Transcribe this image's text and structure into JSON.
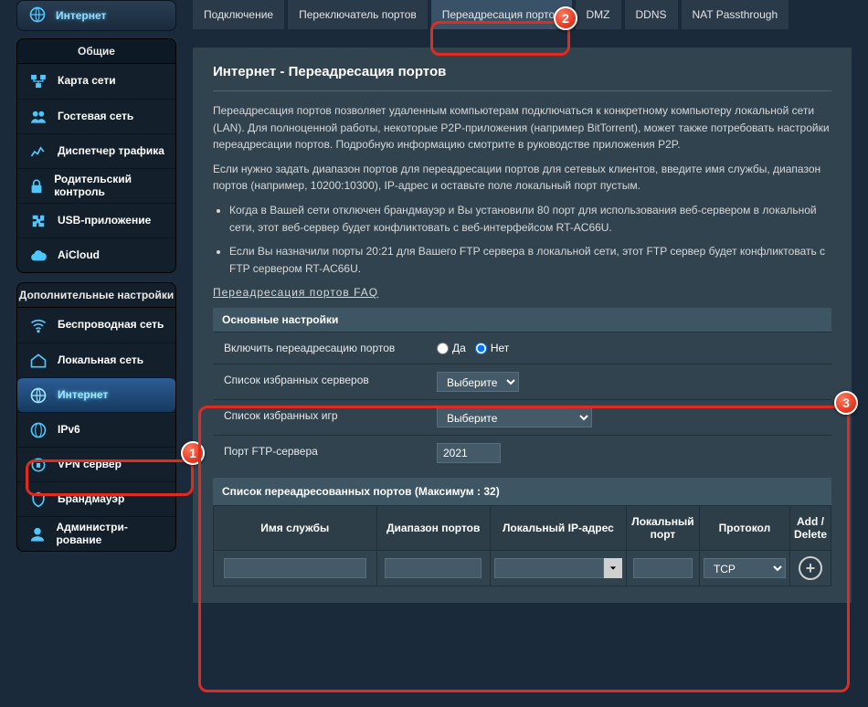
{
  "sidebar": {
    "quick_internet": "Интернет",
    "general_header": "Общие",
    "general_items": [
      {
        "label": "Карта сети",
        "name": "network-map"
      },
      {
        "label": "Гостевая сеть",
        "name": "guest-network"
      },
      {
        "label": "Диспетчер трафика",
        "name": "traffic-manager"
      },
      {
        "label": "Родительский контроль",
        "name": "parental-control"
      },
      {
        "label": "USB-приложение",
        "name": "usb-app"
      },
      {
        "label": "AiCloud",
        "name": "aicloud"
      }
    ],
    "advanced_header": "Дополнительные настройки",
    "advanced_items": [
      {
        "label": "Беспроводная сеть",
        "name": "wireless"
      },
      {
        "label": "Локальная сеть",
        "name": "lan"
      },
      {
        "label": "Интернет",
        "name": "internet",
        "selected": true
      },
      {
        "label": "IPv6",
        "name": "ipv6"
      },
      {
        "label": "VPN сервер",
        "name": "vpn-server"
      },
      {
        "label": "Брандмауэр",
        "name": "firewall"
      },
      {
        "label": "Администри-рование",
        "name": "administration"
      }
    ]
  },
  "tabs": [
    {
      "label": "Подключение",
      "name": "tab-connection"
    },
    {
      "label": "Переключатель портов",
      "name": "tab-port-trigger"
    },
    {
      "label": "Переадресация портов",
      "name": "tab-port-forward",
      "active": true
    },
    {
      "label": "DMZ",
      "name": "tab-dmz"
    },
    {
      "label": "DDNS",
      "name": "tab-ddns"
    },
    {
      "label": "NAT Passthrough",
      "name": "tab-nat"
    }
  ],
  "page": {
    "title": "Интернет - Переадресация портов",
    "para1": "Переадресация портов позволяет удаленным компьютерам подключаться к конкретному компьютеру локальной сети (LAN). Для полноценной работы, некоторые P2P-приложения (например BitTorrent), может также потребовать настройки переадресации портов. Подробную информацию смотрите в руководстве приложения P2P.",
    "para2": "Если нужно задать диапазон портов для переадресации портов для сетевых клиентов, введите имя службы, диапазон портов (например, 10200:10300), IP-адрес и оставьте поле локальный порт пустым.",
    "bullet1": "Когда в Вашей сети отключен брандмауэр и Вы установили 80 порт для использования веб-сервером в локальной сети, этот веб-сервер будет конфликтовать с веб-интерфейсом RT-AC66U.",
    "bullet2": "Если Вы назначили порты 20:21 для Вашего FTP сервера в локальной сети, этот FTP сервер будет конфликтовать с FTP сервером RT-AC66U.",
    "faq": "Переадресация портов FAQ"
  },
  "form": {
    "basic_header": "Основные настройки",
    "enable_label": "Включить переадресацию портов",
    "radio_yes": "Да",
    "radio_no": "Нет",
    "fav_servers_label": "Список избранных серверов",
    "fav_games_label": "Список избранных игр",
    "select_placeholder": "Выберите",
    "ftp_port_label": "Порт FTP-сервера",
    "ftp_port_value": "2021",
    "list_header": "Список переадресованных портов (Максимум : 32)",
    "col_service": "Имя службы",
    "col_range": "Диапазон портов",
    "col_ip": "Локальный IP-адрес",
    "col_localport": "Локальный порт",
    "col_proto": "Протокол",
    "col_action": "Add / Delete",
    "proto_default": "TCP"
  },
  "callouts": {
    "b1": "1",
    "b2": "2",
    "b3": "3"
  }
}
